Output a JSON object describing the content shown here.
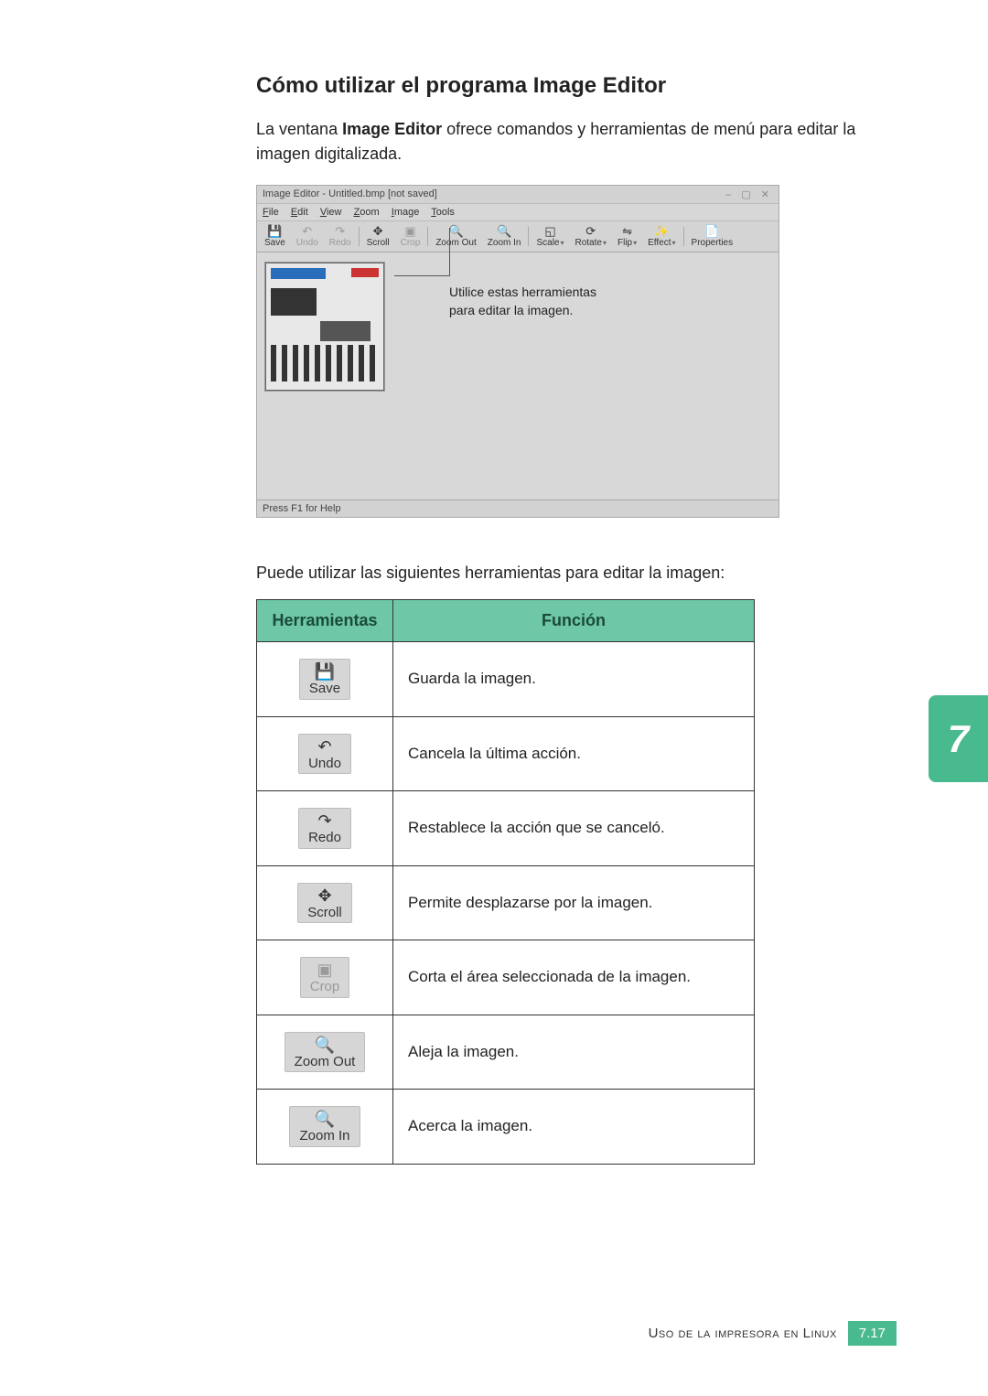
{
  "heading": "Cómo utilizar el programa Image Editor",
  "intro_pre": "La ventana ",
  "intro_bold": "Image Editor",
  "intro_post": " ofrece comandos y herramientas de menú para editar la imagen digitalizada.",
  "window": {
    "title": "Image Editor - Untitled.bmp [not saved]",
    "menus": {
      "file": "File",
      "edit": "Edit",
      "view": "View",
      "zoom": "Zoom",
      "image": "Image",
      "tools": "Tools"
    },
    "toolbar": {
      "save": "Save",
      "undo": "Undo",
      "redo": "Redo",
      "scroll": "Scroll",
      "crop": "Crop",
      "zoom_out": "Zoom Out",
      "zoom_in": "Zoom In",
      "scale": "Scale",
      "rotate": "Rotate",
      "flip": "Flip",
      "effect": "Effect",
      "properties": "Properties"
    },
    "annotation": "Utilice estas herramientas para editar la imagen.",
    "statusbar": "Press F1 for Help"
  },
  "body_text": "Puede utilizar las siguientes herramientas para editar la imagen:",
  "table": {
    "header_tool": "Herramientas",
    "header_func": "Función",
    "rows": [
      {
        "label": "Save",
        "glyph": "💾",
        "disabled": false,
        "func": "Guarda la imagen."
      },
      {
        "label": "Undo",
        "glyph": "↶",
        "disabled": false,
        "func": "Cancela la última acción."
      },
      {
        "label": "Redo",
        "glyph": "↷",
        "disabled": false,
        "func": "Restablece la acción que se canceló."
      },
      {
        "label": "Scroll",
        "glyph": "✥",
        "disabled": false,
        "func": "Permite desplazarse por la imagen."
      },
      {
        "label": "Crop",
        "glyph": "▣",
        "disabled": true,
        "func": "Corta el área seleccionada de la imagen."
      },
      {
        "label": "Zoom Out",
        "glyph": "🔍",
        "disabled": false,
        "func": "Aleja la imagen."
      },
      {
        "label": "Zoom In",
        "glyph": "🔍",
        "disabled": false,
        "func": "Acerca la imagen."
      }
    ]
  },
  "chapter_tab": "7",
  "footer_text": "Uso de la impresora en Linux",
  "page_number": "7.17"
}
